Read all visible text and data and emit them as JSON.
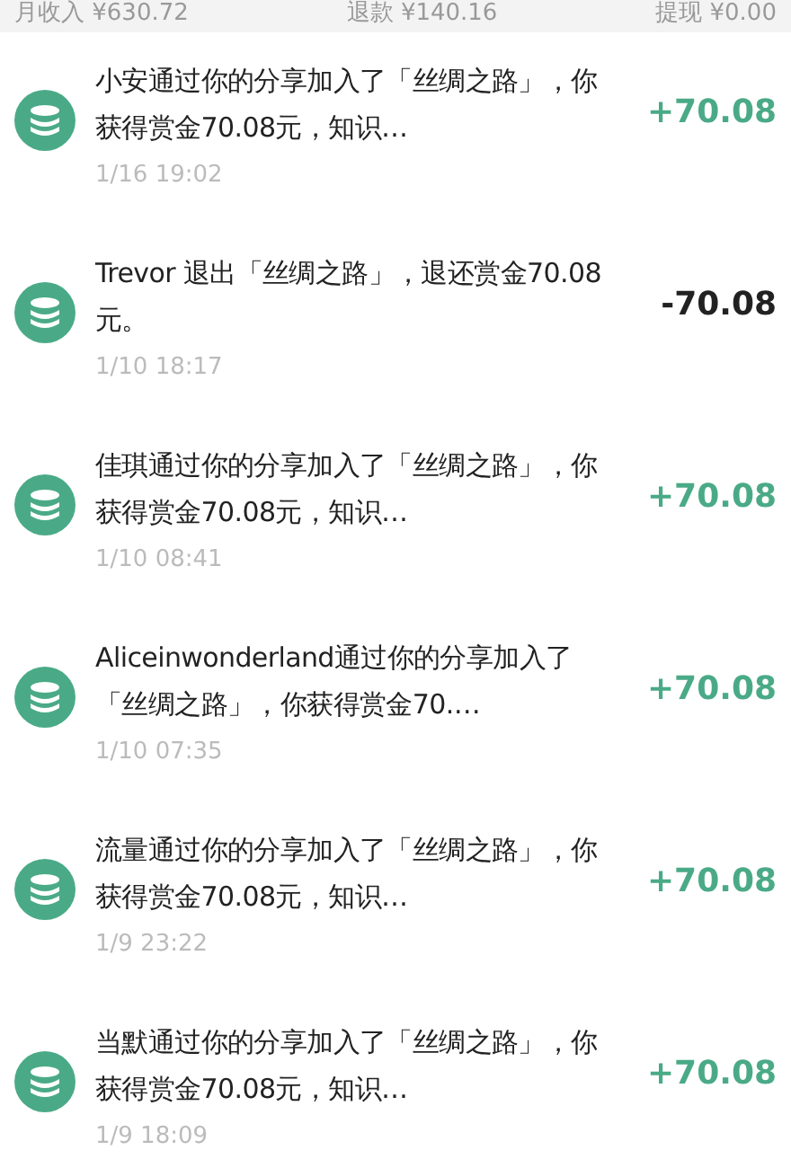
{
  "summary": [
    {
      "label": "月收入 ¥630.72"
    },
    {
      "label": "退款 ¥140.16"
    },
    {
      "label": "提现 ¥0.00"
    }
  ],
  "records": [
    {
      "description": "小安通过你的分享加入了「丝绸之路」，你获得赏金70.08元，知识…",
      "time": "1/16 19:02",
      "amount": "+70.08",
      "kind": "income"
    },
    {
      "description": "Trevor 退出「丝绸之路」，退还赏金70.08元。",
      "time": "1/10 18:17",
      "amount": "-70.08",
      "kind": "refund"
    },
    {
      "description": "佳琪通过你的分享加入了「丝绸之路」，你获得赏金70.08元，知识…",
      "time": "1/10 08:41",
      "amount": "+70.08",
      "kind": "income"
    },
    {
      "description": "Aliceinwonderland通过你的分享加入了「丝绸之路」，你获得赏金70.…",
      "time": "1/10 07:35",
      "amount": "+70.08",
      "kind": "income"
    },
    {
      "description": "流量通过你的分享加入了「丝绸之路」，你获得赏金70.08元，知识…",
      "time": "1/9 23:22",
      "amount": "+70.08",
      "kind": "income"
    },
    {
      "description": "当默通过你的分享加入了「丝绸之路」，你获得赏金70.08元，知识…",
      "time": "1/9 18:09",
      "amount": "+70.08",
      "kind": "income"
    }
  ]
}
